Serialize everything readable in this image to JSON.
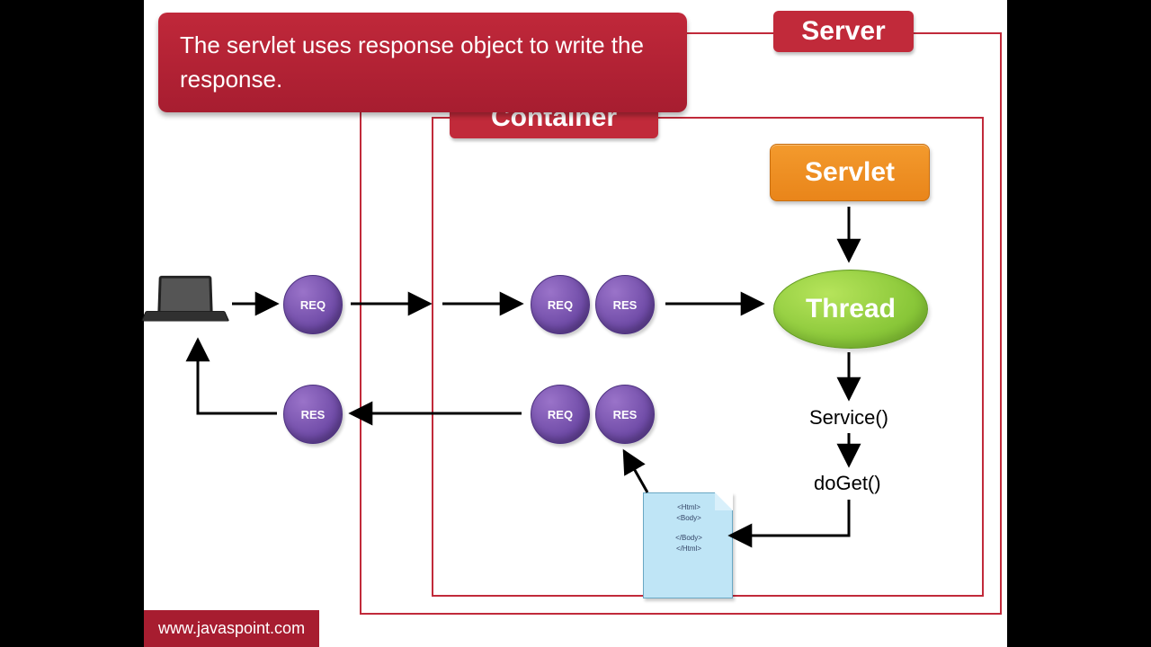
{
  "labels": {
    "server": "Server",
    "container": "Container",
    "caption": "The servlet uses response object to write the response.",
    "servlet": "Servlet",
    "thread": "Thread",
    "service": "Service()",
    "doGet": "doGet()",
    "watermark": "www.javaspoint.com"
  },
  "bubbles": {
    "req": "REQ",
    "res": "RES"
  },
  "doc": {
    "l1": "<Html>",
    "l2": "<Body>",
    "l3": "</Body>",
    "l4": "</Html>"
  }
}
